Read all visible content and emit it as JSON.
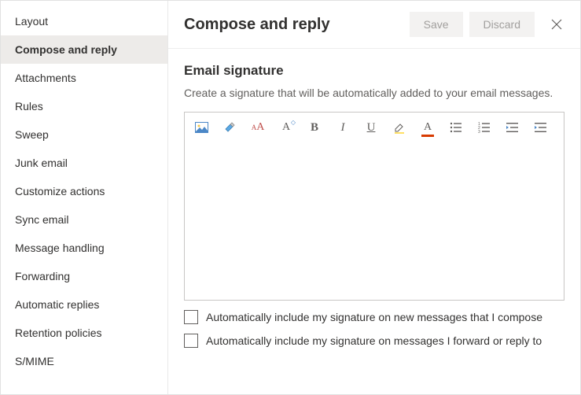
{
  "sidebar": {
    "items": [
      {
        "label": "Layout"
      },
      {
        "label": "Compose and reply"
      },
      {
        "label": "Attachments"
      },
      {
        "label": "Rules"
      },
      {
        "label": "Sweep"
      },
      {
        "label": "Junk email"
      },
      {
        "label": "Customize actions"
      },
      {
        "label": "Sync email"
      },
      {
        "label": "Message handling"
      },
      {
        "label": "Forwarding"
      },
      {
        "label": "Automatic replies"
      },
      {
        "label": "Retention policies"
      },
      {
        "label": "S/MIME"
      }
    ],
    "selected_index": 1
  },
  "header": {
    "title": "Compose and reply",
    "save_label": "Save",
    "discard_label": "Discard"
  },
  "section": {
    "title": "Email signature",
    "description": "Create a signature that will be automatically added to your email messages."
  },
  "editor": {
    "value": ""
  },
  "toolbar_icons": [
    "image-icon",
    "format-painter-icon",
    "font-size-icon",
    "clear-format-icon",
    "bold-icon",
    "italic-icon",
    "underline-icon",
    "highlight-icon",
    "font-color-icon",
    "bullet-list-icon",
    "number-list-icon",
    "outdent-icon",
    "indent-icon"
  ],
  "checkboxes": {
    "new_messages": {
      "label": "Automatically include my signature on new messages that I compose",
      "checked": false
    },
    "replies": {
      "label": "Automatically include my signature on messages I forward or reply to",
      "checked": false
    }
  }
}
